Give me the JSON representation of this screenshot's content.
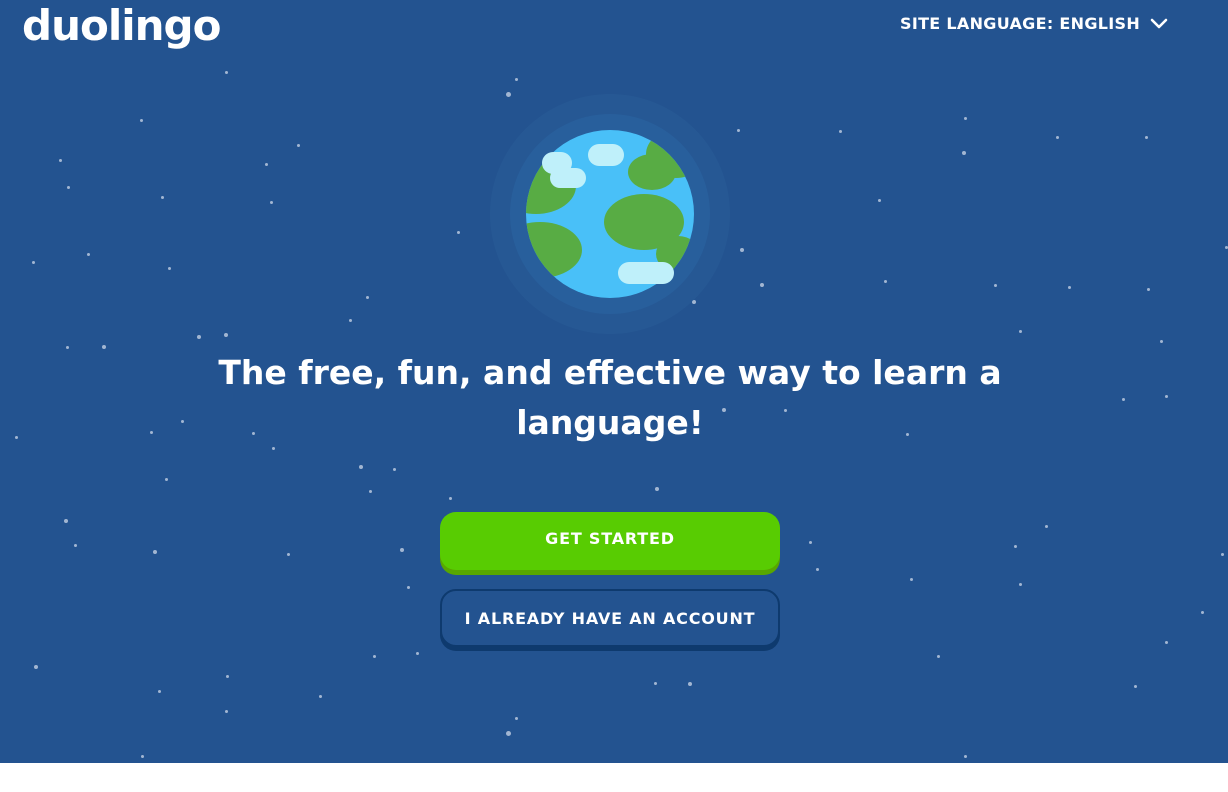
{
  "header": {
    "logo_text": "duolingo",
    "site_language_label": "SITE LANGUAGE: ENGLISH"
  },
  "hero": {
    "headline": "The free, fun, and effective way to learn a language!",
    "primary_button": "GET STARTED",
    "secondary_button": "I ALREADY HAVE AN ACCOUNT"
  },
  "icons": {
    "dropdown": "chevron-down-icon",
    "illustration": "globe-icon"
  },
  "colors": {
    "background": "#235390",
    "primary": "#58cc02",
    "primary_shadow": "#58a700",
    "text": "#ffffff",
    "footer": "#ffffff"
  }
}
